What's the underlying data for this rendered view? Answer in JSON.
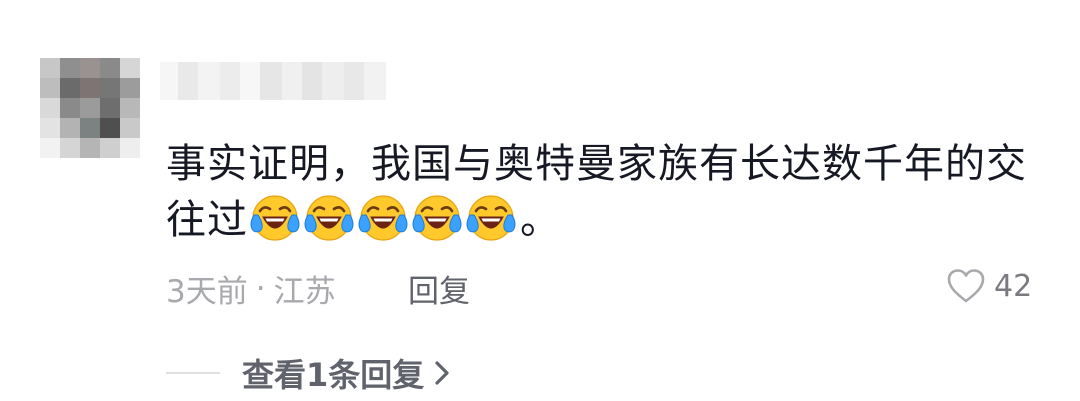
{
  "comment": {
    "text": "事实证明，我国与奥特曼家族有长达数千年的交往过",
    "emoji": "face-with-tears-of-joy",
    "emoji_count": 5,
    "end_punct": "。",
    "time": "3天前",
    "separator": "·",
    "location": "江苏",
    "reply_label": "回复",
    "like_count": "42"
  },
  "replies": {
    "view_label": "查看1条回复"
  },
  "colors": {
    "text_primary": "#161823",
    "text_meta": "#a8a9ad",
    "text_action": "#60636b"
  },
  "icons": {
    "like": "heart-outline-icon",
    "expand": "chevron-right-icon"
  }
}
